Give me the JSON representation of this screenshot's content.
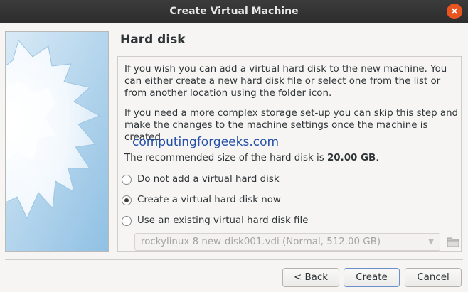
{
  "window": {
    "title": "Create Virtual Machine",
    "close_icon": "×"
  },
  "page": {
    "title": "Hard disk",
    "paragraph1": "If you wish you can add a virtual hard disk to the new machine. You can either create a new hard disk file or select one from the list or from another location using the folder icon.",
    "paragraph2": "If you need a more complex storage set-up you can skip this step and make the changes to the machine settings once the machine is created.",
    "recommended_prefix": "The recommended size of the hard disk is ",
    "recommended_size": "20.00 GB",
    "recommended_suffix": ".",
    "watermark": "computingforgeeks.com"
  },
  "options": [
    {
      "label": "Do not add a virtual hard disk",
      "selected": false
    },
    {
      "label": "Create a virtual hard disk now",
      "selected": true
    },
    {
      "label": "Use an existing virtual hard disk file",
      "selected": false
    }
  ],
  "existing_disk": {
    "value": "rockylinux 8 new-disk001.vdi (Normal, 512.00 GB)",
    "enabled": false
  },
  "buttons": {
    "back": "< Back",
    "create": "Create",
    "cancel": "Cancel"
  },
  "colors": {
    "titlebar": "#2d2d2d",
    "close_button": "#e95420",
    "watermark": "#2450a8"
  }
}
